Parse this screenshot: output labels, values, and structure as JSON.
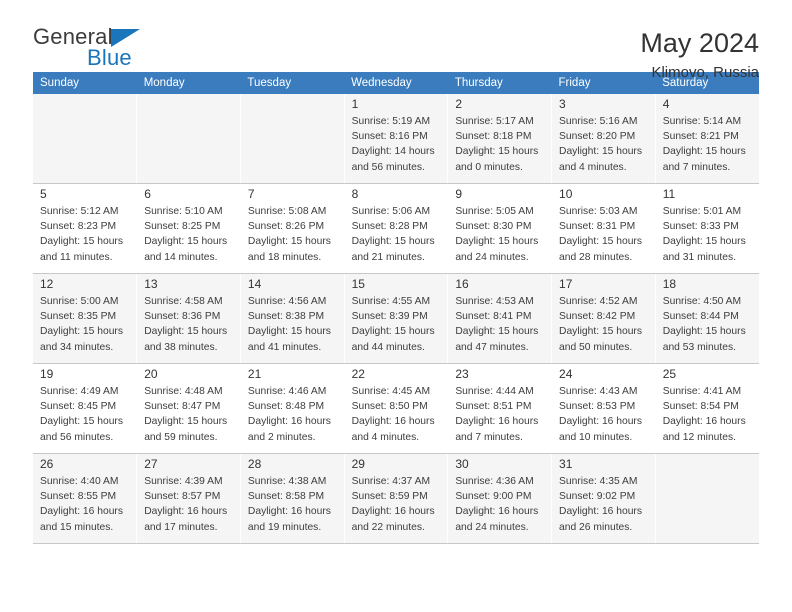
{
  "brand": {
    "name_part1": "General",
    "name_part2": "Blue",
    "flag_icon": "triangle-flag-icon"
  },
  "header": {
    "title": "May 2024",
    "subtitle": "Klimovo, Russia"
  },
  "calendar": {
    "weekday_headers": [
      "Sunday",
      "Monday",
      "Tuesday",
      "Wednesday",
      "Thursday",
      "Friday",
      "Saturday"
    ],
    "accent_color": "#3a7cbe",
    "alt_row_color": "#f5f5f5",
    "weeks": [
      [
        {
          "day": "",
          "sunrise": "",
          "sunset": "",
          "daylight": ""
        },
        {
          "day": "",
          "sunrise": "",
          "sunset": "",
          "daylight": ""
        },
        {
          "day": "",
          "sunrise": "",
          "sunset": "",
          "daylight": ""
        },
        {
          "day": "1",
          "sunrise": "Sunrise: 5:19 AM",
          "sunset": "Sunset: 8:16 PM",
          "daylight": "Daylight: 14 hours and 56 minutes."
        },
        {
          "day": "2",
          "sunrise": "Sunrise: 5:17 AM",
          "sunset": "Sunset: 8:18 PM",
          "daylight": "Daylight: 15 hours and 0 minutes."
        },
        {
          "day": "3",
          "sunrise": "Sunrise: 5:16 AM",
          "sunset": "Sunset: 8:20 PM",
          "daylight": "Daylight: 15 hours and 4 minutes."
        },
        {
          "day": "4",
          "sunrise": "Sunrise: 5:14 AM",
          "sunset": "Sunset: 8:21 PM",
          "daylight": "Daylight: 15 hours and 7 minutes."
        }
      ],
      [
        {
          "day": "5",
          "sunrise": "Sunrise: 5:12 AM",
          "sunset": "Sunset: 8:23 PM",
          "daylight": "Daylight: 15 hours and 11 minutes."
        },
        {
          "day": "6",
          "sunrise": "Sunrise: 5:10 AM",
          "sunset": "Sunset: 8:25 PM",
          "daylight": "Daylight: 15 hours and 14 minutes."
        },
        {
          "day": "7",
          "sunrise": "Sunrise: 5:08 AM",
          "sunset": "Sunset: 8:26 PM",
          "daylight": "Daylight: 15 hours and 18 minutes."
        },
        {
          "day": "8",
          "sunrise": "Sunrise: 5:06 AM",
          "sunset": "Sunset: 8:28 PM",
          "daylight": "Daylight: 15 hours and 21 minutes."
        },
        {
          "day": "9",
          "sunrise": "Sunrise: 5:05 AM",
          "sunset": "Sunset: 8:30 PM",
          "daylight": "Daylight: 15 hours and 24 minutes."
        },
        {
          "day": "10",
          "sunrise": "Sunrise: 5:03 AM",
          "sunset": "Sunset: 8:31 PM",
          "daylight": "Daylight: 15 hours and 28 minutes."
        },
        {
          "day": "11",
          "sunrise": "Sunrise: 5:01 AM",
          "sunset": "Sunset: 8:33 PM",
          "daylight": "Daylight: 15 hours and 31 minutes."
        }
      ],
      [
        {
          "day": "12",
          "sunrise": "Sunrise: 5:00 AM",
          "sunset": "Sunset: 8:35 PM",
          "daylight": "Daylight: 15 hours and 34 minutes."
        },
        {
          "day": "13",
          "sunrise": "Sunrise: 4:58 AM",
          "sunset": "Sunset: 8:36 PM",
          "daylight": "Daylight: 15 hours and 38 minutes."
        },
        {
          "day": "14",
          "sunrise": "Sunrise: 4:56 AM",
          "sunset": "Sunset: 8:38 PM",
          "daylight": "Daylight: 15 hours and 41 minutes."
        },
        {
          "day": "15",
          "sunrise": "Sunrise: 4:55 AM",
          "sunset": "Sunset: 8:39 PM",
          "daylight": "Daylight: 15 hours and 44 minutes."
        },
        {
          "day": "16",
          "sunrise": "Sunrise: 4:53 AM",
          "sunset": "Sunset: 8:41 PM",
          "daylight": "Daylight: 15 hours and 47 minutes."
        },
        {
          "day": "17",
          "sunrise": "Sunrise: 4:52 AM",
          "sunset": "Sunset: 8:42 PM",
          "daylight": "Daylight: 15 hours and 50 minutes."
        },
        {
          "day": "18",
          "sunrise": "Sunrise: 4:50 AM",
          "sunset": "Sunset: 8:44 PM",
          "daylight": "Daylight: 15 hours and 53 minutes."
        }
      ],
      [
        {
          "day": "19",
          "sunrise": "Sunrise: 4:49 AM",
          "sunset": "Sunset: 8:45 PM",
          "daylight": "Daylight: 15 hours and 56 minutes."
        },
        {
          "day": "20",
          "sunrise": "Sunrise: 4:48 AM",
          "sunset": "Sunset: 8:47 PM",
          "daylight": "Daylight: 15 hours and 59 minutes."
        },
        {
          "day": "21",
          "sunrise": "Sunrise: 4:46 AM",
          "sunset": "Sunset: 8:48 PM",
          "daylight": "Daylight: 16 hours and 2 minutes."
        },
        {
          "day": "22",
          "sunrise": "Sunrise: 4:45 AM",
          "sunset": "Sunset: 8:50 PM",
          "daylight": "Daylight: 16 hours and 4 minutes."
        },
        {
          "day": "23",
          "sunrise": "Sunrise: 4:44 AM",
          "sunset": "Sunset: 8:51 PM",
          "daylight": "Daylight: 16 hours and 7 minutes."
        },
        {
          "day": "24",
          "sunrise": "Sunrise: 4:43 AM",
          "sunset": "Sunset: 8:53 PM",
          "daylight": "Daylight: 16 hours and 10 minutes."
        },
        {
          "day": "25",
          "sunrise": "Sunrise: 4:41 AM",
          "sunset": "Sunset: 8:54 PM",
          "daylight": "Daylight: 16 hours and 12 minutes."
        }
      ],
      [
        {
          "day": "26",
          "sunrise": "Sunrise: 4:40 AM",
          "sunset": "Sunset: 8:55 PM",
          "daylight": "Daylight: 16 hours and 15 minutes."
        },
        {
          "day": "27",
          "sunrise": "Sunrise: 4:39 AM",
          "sunset": "Sunset: 8:57 PM",
          "daylight": "Daylight: 16 hours and 17 minutes."
        },
        {
          "day": "28",
          "sunrise": "Sunrise: 4:38 AM",
          "sunset": "Sunset: 8:58 PM",
          "daylight": "Daylight: 16 hours and 19 minutes."
        },
        {
          "day": "29",
          "sunrise": "Sunrise: 4:37 AM",
          "sunset": "Sunset: 8:59 PM",
          "daylight": "Daylight: 16 hours and 22 minutes."
        },
        {
          "day": "30",
          "sunrise": "Sunrise: 4:36 AM",
          "sunset": "Sunset: 9:00 PM",
          "daylight": "Daylight: 16 hours and 24 minutes."
        },
        {
          "day": "31",
          "sunrise": "Sunrise: 4:35 AM",
          "sunset": "Sunset: 9:02 PM",
          "daylight": "Daylight: 16 hours and 26 minutes."
        },
        {
          "day": "",
          "sunrise": "",
          "sunset": "",
          "daylight": ""
        }
      ]
    ]
  }
}
